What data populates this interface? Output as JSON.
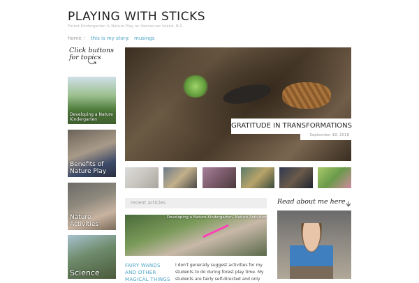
{
  "header": {
    "title": "PLAYING WITH STICKS",
    "tagline": "Forest Kindergarten & Nature Play on Vancouver Island, B.C."
  },
  "nav": {
    "items": [
      {
        "label": "home"
      },
      {
        "label": "this is my story."
      },
      {
        "label": "musings"
      }
    ],
    "separator": "/"
  },
  "sidebar": {
    "note": "Click buttons for topics",
    "tiles": [
      {
        "label": "Developing a Nature Kindergarten"
      },
      {
        "label": "Benefits of Nature Play"
      },
      {
        "label": "Nature Activities"
      },
      {
        "label": "Science"
      }
    ]
  },
  "hero": {
    "caption": "GRATITUDE IN TRANSFORMATIONS",
    "date": "September 18, 2018"
  },
  "recent": {
    "heading": "recent articles",
    "article": {
      "image_caption": "Developing a Nature Kindergarten, Nature Activities",
      "title": "FAIRY WANDS AND OTHER MAGICAL THINGS",
      "excerpt": "I don't generally suggest activities for my students to do during forest play time. My students are fairly self-directed and only"
    }
  },
  "about": {
    "note": "Read about me here"
  },
  "colors": {
    "link": "#4aa3c4",
    "muted": "#9a9a9a",
    "accent_pink": "#ff3fb8"
  }
}
